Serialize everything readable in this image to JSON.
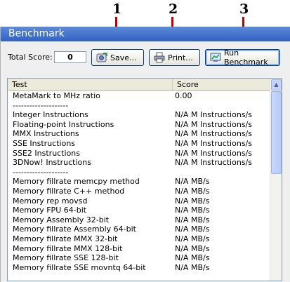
{
  "callouts": [
    "1",
    "2",
    "3"
  ],
  "panel": {
    "title": "Benchmark"
  },
  "toolbar": {
    "total_score_label": "Total Score:",
    "total_score_value": "0",
    "save_label": "Save...",
    "print_label": "Print...",
    "run_label": "Run Benchmark"
  },
  "list": {
    "columns": [
      "Test",
      "Score"
    ],
    "rows": [
      [
        "MetaMark to MHz ratio",
        "0.00"
      ],
      [
        "--------------------",
        ""
      ],
      [
        "Integer Instructions",
        "N/A M Instructions/s"
      ],
      [
        "Floating-point Instructions",
        "N/A M Instructions/s"
      ],
      [
        "MMX Instructions",
        "N/A M Instructions/s"
      ],
      [
        "SSE Instructions",
        "N/A M Instructions/s"
      ],
      [
        "SSE2 Instructions",
        "N/A M Instructions/s"
      ],
      [
        "3DNow! Instructions",
        "N/A M Instructions/s"
      ],
      [
        "--------------------",
        ""
      ],
      [
        "Memory fillrate memcpy method",
        "N/A MB/s"
      ],
      [
        "Memory fillrate C++ method",
        "N/A MB/s"
      ],
      [
        "Memory rep movsd",
        "N/A MB/s"
      ],
      [
        "Memory FPU 64-bit",
        "N/A MB/s"
      ],
      [
        "Memory Assembly 32-bit",
        "N/A MB/s"
      ],
      [
        "Memory fillrate Assembly 64-bit",
        "N/A MB/s"
      ],
      [
        "Memory fillrate MMX 32-bit",
        "N/A MB/s"
      ],
      [
        "Memory fillrate MMX 128-bit",
        "N/A MB/s"
      ],
      [
        "Memory fillrate SSE 128-bit",
        "N/A MB/s"
      ],
      [
        "Memory fillrate SSE movntq 64-bit",
        "N/A MB/s"
      ]
    ]
  },
  "colors": {
    "header": "#2f62c2",
    "arrow": "#c00000"
  }
}
